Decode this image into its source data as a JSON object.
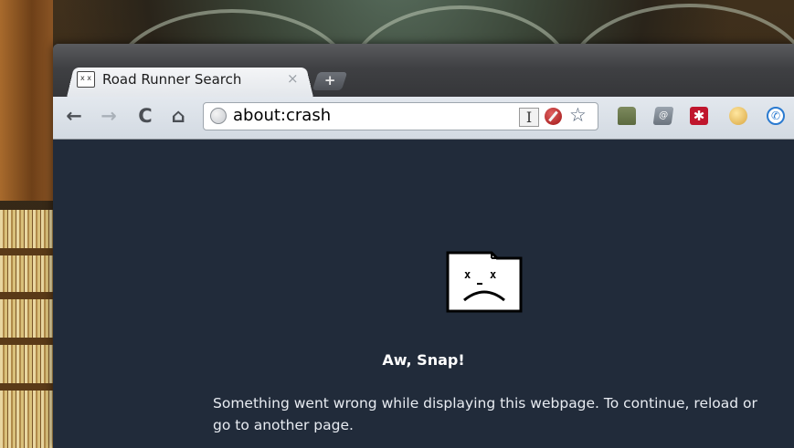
{
  "browser": {
    "tab": {
      "title": "Road Runner Search",
      "close_glyph": "×",
      "favicon": "sad-tab-favicon"
    },
    "new_tab_glyph": "+",
    "toolbar": {
      "back_glyph": "←",
      "forward_glyph": "→",
      "reload_glyph": "C",
      "home_glyph": "⌂",
      "url": "about:crash",
      "star_glyph": "☆",
      "ext_i_label": "I",
      "lastpass_glyph": "✱",
      "mail_glyph": "@",
      "phone_glyph": "✆"
    }
  },
  "page": {
    "heading": "Aw, Snap!",
    "message": "Something went wrong while displaying this webpage. To continue, reload or go to another page."
  },
  "colors": {
    "content_background": "#212b3a",
    "toolbar": "#dde3ea",
    "titlebar": "#3f4043"
  }
}
